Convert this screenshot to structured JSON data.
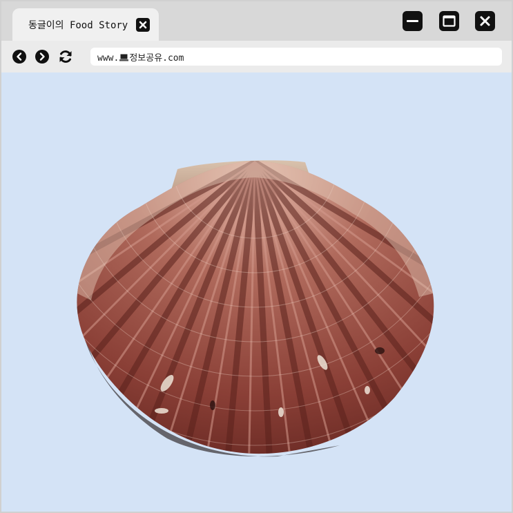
{
  "tab": {
    "title": "동글이의 Food Story",
    "close_icon": "close-icon"
  },
  "window_controls": {
    "minimize_icon": "minimize-icon",
    "maximize_icon": "maximize-icon",
    "close_icon": "close-icon"
  },
  "toolbar": {
    "back_icon": "back-icon",
    "forward_icon": "forward-icon",
    "reload_icon": "reload-icon",
    "url_prefix": "www.",
    "url_glyph": "laptop-icon",
    "url_suffix": "정보공유.com"
  },
  "content": {
    "image": "scallop-shell",
    "background_color": "#d4e3f6"
  },
  "colors": {
    "tabbar": "#d8d8d8",
    "tab": "#f0f0f0",
    "toolbar": "#ebebeb",
    "icon": "#111111"
  }
}
